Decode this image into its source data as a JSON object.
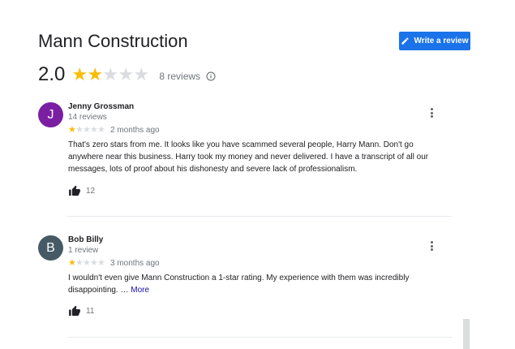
{
  "business": {
    "name": "Mann Construction",
    "rating": "2.0",
    "rating_value": 2,
    "reviews_count": "8 reviews",
    "write_review_label": "Write a review",
    "write_icon": "pencil-icon",
    "info_icon": "info-icon"
  },
  "colors": {
    "accent": "#1a73e8",
    "star_filled": "#fbbc04",
    "star_empty": "#dadce0",
    "avatar_j": "#7b1fa2",
    "avatar_b": "#455a64",
    "link": "#1a0dab"
  },
  "reviews": [
    {
      "initial": "J",
      "name": "Jenny Grossman",
      "sub": "14 reviews",
      "stars": 1,
      "date": "2 months ago",
      "text": "That's zero stars from me. It looks like you have scammed several people, Harry Mann. Don't go anywhere near this business.  Harry took my money and never delivered. I have a transcript of all our messages, lots of proof about his dishonesty and severe lack of professionalism.",
      "more": "",
      "likes": "12"
    },
    {
      "initial": "B",
      "name": "Bob Billy",
      "sub": "1 review",
      "stars": 1,
      "date": "3 months ago",
      "text": "I wouldn't even give Mann Construction a 1-star rating. My experience with them was incredibly disappointing. …",
      "more": "More",
      "likes": "11"
    }
  ]
}
